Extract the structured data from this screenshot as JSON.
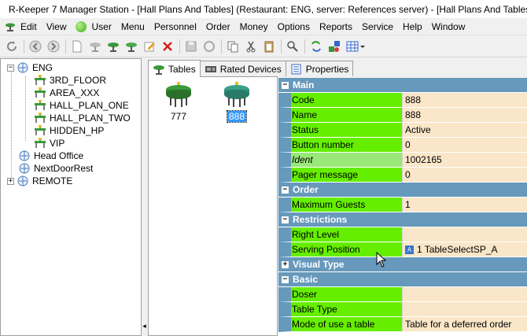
{
  "window": {
    "title": "R-Keeper 7 Manager Station - [Hall Plans And Tables] (Restaurant: ENG, server: References server) - [Hall Plans And Tables]"
  },
  "menu": [
    {
      "label": "Edit",
      "key": "E"
    },
    {
      "label": "View",
      "key": "V"
    },
    {
      "label": "User",
      "key": "U"
    },
    {
      "label": "Menu",
      "key": "n"
    },
    {
      "label": "Personnel",
      "key": "P"
    },
    {
      "label": "Order",
      "key": "O"
    },
    {
      "label": "Money",
      "key": "M"
    },
    {
      "label": "Options",
      "key": "t"
    },
    {
      "label": "Reports",
      "key": "R"
    },
    {
      "label": "Service",
      "key": "S"
    },
    {
      "label": "Help",
      "key": "H"
    },
    {
      "label": "Window",
      "key": "W"
    }
  ],
  "toolbar": {
    "icons": [
      "refresh-icon",
      "back-icon",
      "forward-icon",
      "new-document-icon",
      "table-gray-icon",
      "table-green-icon",
      "table-green-2-icon",
      "edit-icon",
      "delete-icon",
      "save-icon",
      "undo-icon",
      "copy-icon",
      "cut-icon",
      "paste-icon",
      "find-icon",
      "refresh-green-icon",
      "shapes-icon",
      "grid-view-icon"
    ]
  },
  "tree": {
    "root": "ENG",
    "children": [
      "3RD_FLOOR",
      "AREA_XXX",
      "HALL_PLAN_ONE",
      "HALL_PLAN_TWO",
      "HIDDEN_HP",
      "VIP"
    ],
    "siblings": [
      "Head Office",
      "NextDoorRest",
      "REMOTE"
    ]
  },
  "tabs": [
    {
      "label": "Tables"
    },
    {
      "label": "Rated Devices"
    },
    {
      "label": "Properties"
    }
  ],
  "tables": [
    {
      "label": "777",
      "color": "#3a9a3a",
      "selected": false
    },
    {
      "label": "888",
      "color": "#3aa08a",
      "selected": true
    }
  ],
  "properties": {
    "groups": [
      {
        "name": "Main",
        "rows": [
          {
            "name": "Code",
            "value": "888"
          },
          {
            "name": "Name",
            "value": "888"
          },
          {
            "name": "Status",
            "value": "Active"
          },
          {
            "name": "Button number",
            "value": "0"
          },
          {
            "name": "Ident",
            "value": "1002165"
          },
          {
            "name": "Pager message",
            "value": "0"
          }
        ]
      },
      {
        "name": "Order",
        "rows": [
          {
            "name": "Maximum Guests",
            "value": "1"
          }
        ]
      },
      {
        "name": "Restrictions",
        "rows": [
          {
            "name": "Right Level",
            "value": ""
          },
          {
            "name": "Serving Position",
            "value": "1 TableSelectSP_A"
          }
        ]
      },
      {
        "name": "Visual Type",
        "rows": []
      },
      {
        "name": "Basic",
        "rows": [
          {
            "name": "Doser",
            "value": ""
          },
          {
            "name": "Table Type",
            "value": ""
          },
          {
            "name": "Mode of use a table",
            "value": "Table for a deferred order"
          }
        ]
      }
    ]
  },
  "colors": {
    "group_header": "#6699bb",
    "name_cell": "#66ee00",
    "value_cell": "#fae6c8",
    "selection": "#3399ff"
  }
}
